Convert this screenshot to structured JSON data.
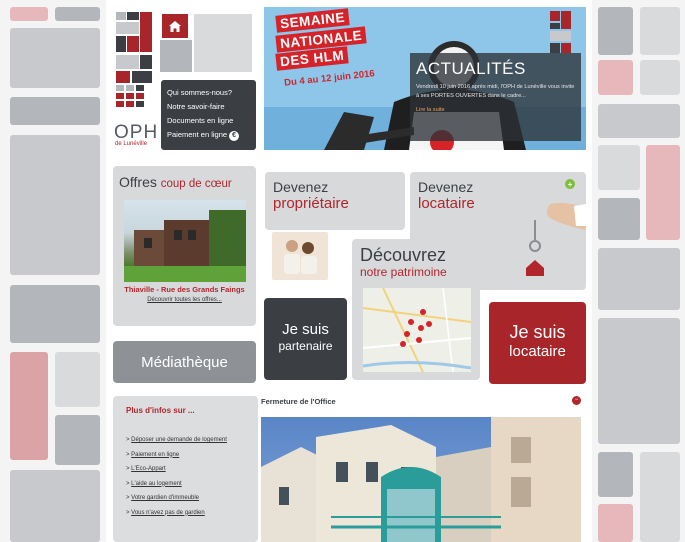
{
  "nav": {
    "items": [
      {
        "label": "Qui sommes-nous?"
      },
      {
        "label": "Notre savoir-faire"
      },
      {
        "label": "Documents en ligne"
      },
      {
        "label": "Paiement en ligne"
      }
    ],
    "euro_symbol": "€"
  },
  "logo": {
    "name": "OPH",
    "sub": "de Lunéville"
  },
  "banner": {
    "title_lines": [
      "SEMAINE",
      "NATIONALE",
      "DES HLM"
    ],
    "date": "Du 4 au 12 juin 2016",
    "news_title": "ACTUALITÉS",
    "news_text": "Vendredi 10 juin 2016 après midi, l'OPH de Lunéville vous invite à ses PORTES OUVERTES dans le cadre...",
    "news_link": "Lire la suite"
  },
  "offres": {
    "title": "Offres",
    "title_accent": "coup de cœur",
    "caption": "Thiaville - Rue des Grands Faings",
    "link": "Découvrir toutes les offres..."
  },
  "cta": {
    "proprietaire": {
      "line1": "Devenez",
      "line2": "propriétaire"
    },
    "locataire": {
      "line1": "Devenez",
      "line2": "locataire"
    },
    "patrimoine": {
      "line1": "Découvrez",
      "line2": "notre patrimoine"
    },
    "partenaire": {
      "line1": "Je suis",
      "line2": "partenaire"
    },
    "je_locataire": {
      "line1": "Je suis",
      "line2": "locataire"
    },
    "mediatheque": "Médiathèque"
  },
  "infos": {
    "title": "Plus d'infos sur ...",
    "links": [
      "Déposer une demande de logement",
      "Paiement en ligne",
      "L'Eco-Appart",
      "L'aide au logement",
      "Votre gardien d'immeuble",
      "Vous n'avez pas de gardien"
    ]
  },
  "fermeture": {
    "title": "Fermeture de l'Office"
  },
  "colors": {
    "brand_red": "#b1262d",
    "dark_gray": "#3b3f44",
    "banner_blue": "#8ec6ea",
    "panel_gray": "#d8d9db"
  },
  "icons": [
    "home-icon",
    "euro-icon",
    "key-icon",
    "map-pin-icon",
    "close-icon",
    "plus-icon"
  ]
}
